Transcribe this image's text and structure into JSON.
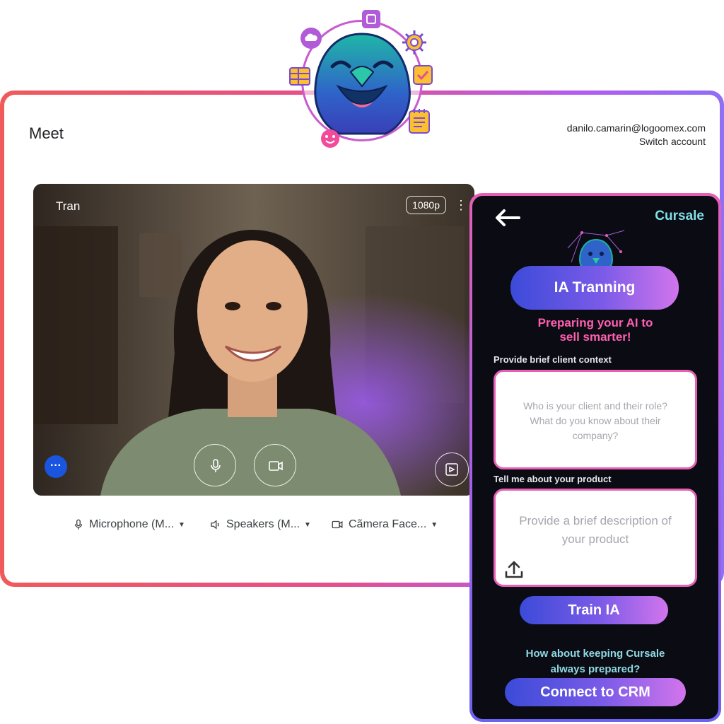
{
  "meet": {
    "title": "Meet",
    "account_email": "danilo.camarin@logoomex.com",
    "switch_account": "Switch account",
    "participant_name": "Tran",
    "resolution": "1080p",
    "devices": {
      "microphone": "Microphone (M...",
      "speakers": "Speakers (M...",
      "camera": "Cãmera Face..."
    }
  },
  "cursale": {
    "brand": "Cursale",
    "title_button": "IA Tranning",
    "tagline_line1": "Preparing your AI to",
    "tagline_line2": "sell smarter!",
    "client_label": "Provide brief client context",
    "client_placeholder_1": "Who is your client and their role?",
    "client_placeholder_2": "What do you know about their",
    "client_placeholder_3": "company?",
    "product_label": "Tell me about your product",
    "product_placeholder_1": "Provide a brief description of",
    "product_placeholder_2": "your product",
    "train_button": "Train IA",
    "prompt_line1": "How about keeping Cursale",
    "prompt_line2": "always prepared?",
    "crm_button": "Connect to CRM"
  },
  "colors": {
    "accent_pink": "#ff5fb0",
    "accent_cyan": "#7fe0e6",
    "meet_blue": "#1a55e0",
    "panel_bg": "#0b0b14"
  }
}
